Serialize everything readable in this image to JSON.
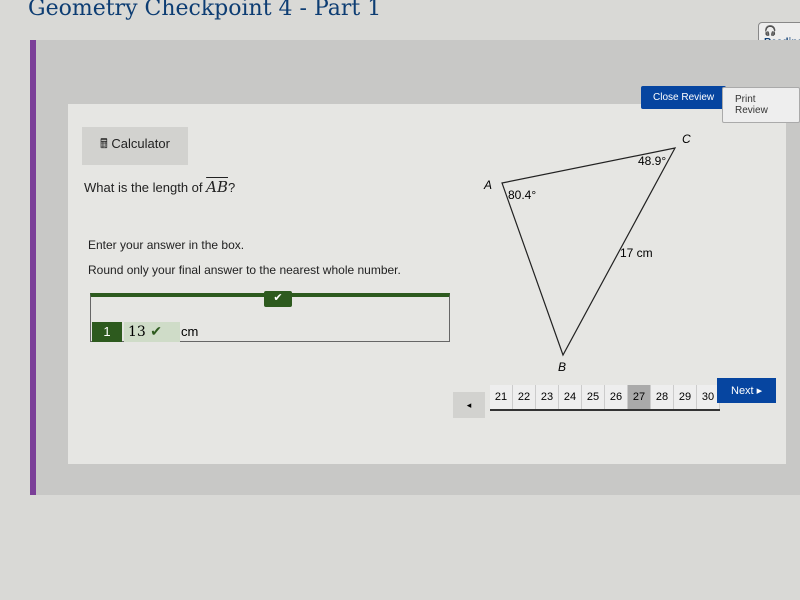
{
  "header": {
    "title": "Geometry Checkpoint 4 - Part 1",
    "reading_label": "Reading"
  },
  "toolbar": {
    "close_review": "Close Review",
    "print_review": "Print Review"
  },
  "calculator": {
    "label": "Calculator",
    "icon": "calculator-icon"
  },
  "question": {
    "prefix": "What is the length of ",
    "segment": "AB",
    "suffix": "?",
    "instruction1": "Enter your answer in the box.",
    "instruction2": "Round only your final answer to the nearest whole number."
  },
  "answer": {
    "number": "1",
    "value": "13",
    "unit": "cm",
    "status": "correct"
  },
  "figure": {
    "labels": {
      "a": "A",
      "b": "B",
      "c": "C"
    },
    "angle_a": "80.4°",
    "angle_c": "48.9°",
    "side_bc": "17 cm"
  },
  "pagination": {
    "prev": "◂",
    "pages": [
      "21",
      "22",
      "23",
      "24",
      "25",
      "26",
      "27",
      "28",
      "29",
      "30"
    ],
    "current": "27",
    "next": "Next ▸"
  },
  "colors": {
    "accent": "#0645a0",
    "correct": "#2d5a1e",
    "bar": "#7b3f98"
  }
}
